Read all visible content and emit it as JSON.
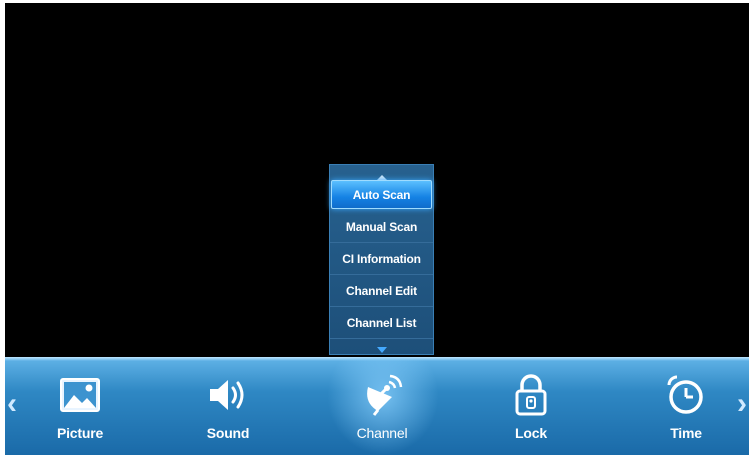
{
  "submenu": {
    "items": [
      {
        "label": "Auto Scan",
        "selected": true
      },
      {
        "label": "Manual Scan",
        "selected": false
      },
      {
        "label": "CI Information",
        "selected": false
      },
      {
        "label": "Channel Edit",
        "selected": false
      },
      {
        "label": "Channel List",
        "selected": false
      }
    ]
  },
  "menu_bar": {
    "items": [
      {
        "label": "Picture",
        "icon": "picture-icon"
      },
      {
        "label": "Sound",
        "icon": "speaker-icon"
      },
      {
        "label": "Channel",
        "icon": "satellite-dish-icon",
        "active": true
      },
      {
        "label": "Lock",
        "icon": "padlock-icon"
      },
      {
        "label": "Time",
        "icon": "clock-icon"
      }
    ],
    "nav_left": "‹",
    "nav_right": "›"
  },
  "colors": {
    "selected_item": "#1582e4",
    "bar": "#2f88c4",
    "submenu_bg": "#27618f"
  }
}
